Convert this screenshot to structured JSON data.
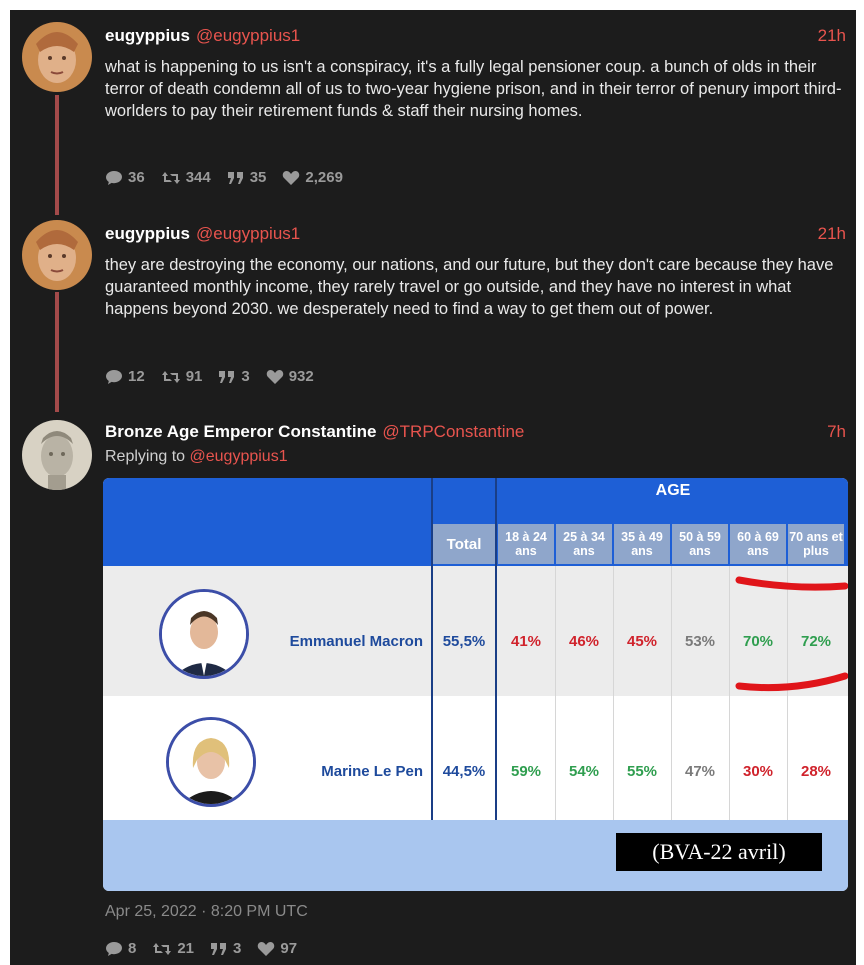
{
  "tweets": [
    {
      "name": "eugyppius",
      "handle": "@eugyppius1",
      "time": "21h",
      "text": "what is happening to us isn't a conspiracy, it's a fully legal pensioner coup. a bunch of olds in their terror of death condemn all of us to two-year hygiene prison, and in their terror of penury import third-worlders to pay their retirement funds & staff their nursing homes.",
      "replies": "36",
      "retweets": "344",
      "quotes": "35",
      "likes": "2,269"
    },
    {
      "name": "eugyppius",
      "handle": "@eugyppius1",
      "time": "21h",
      "text": "they are destroying the economy, our nations, and our future, but they don't care because they have guaranteed monthly income, they rarely travel or go outside, and they have no interest in what happens beyond 2030. we desperately need to find a way to get them out of power.",
      "replies": "12",
      "retweets": "91",
      "quotes": "3",
      "likes": "932"
    },
    {
      "name": "Bronze Age Emperor Constantine",
      "handle": "@TRPConstantine",
      "time": "7h",
      "replying_label": "Replying to",
      "replying_handle": "@eugyppius1",
      "date": "Apr 25, 2022 · 8:20 PM UTC",
      "replies": "8",
      "retweets": "21",
      "quotes": "3",
      "likes": "97"
    }
  ],
  "poll": {
    "age_label": "AGE",
    "total_label": "Total",
    "age_groups": [
      "18 à 24 ans",
      "25 à 34 ans",
      "35 à 49 ans",
      "50 à 59 ans",
      "60 à 69 ans",
      "70 ans et plus"
    ],
    "rows": [
      {
        "candidate": "Emmanuel Macron",
        "total": "55,5%",
        "values": [
          "41%",
          "46%",
          "45%",
          "53%",
          "70%",
          "72%"
        ],
        "colors": [
          "red",
          "red",
          "red",
          "grey",
          "green",
          "green"
        ]
      },
      {
        "candidate": "Marine Le Pen",
        "total": "44,5%",
        "values": [
          "59%",
          "54%",
          "55%",
          "47%",
          "30%",
          "28%"
        ],
        "colors": [
          "green",
          "green",
          "green",
          "grey",
          "red",
          "red"
        ]
      }
    ],
    "source": "(BVA-22 avril)"
  },
  "icons": {
    "reply": "comment-icon",
    "retweet": "retweet-icon",
    "quote": "quote-icon",
    "like": "heart-icon"
  }
}
